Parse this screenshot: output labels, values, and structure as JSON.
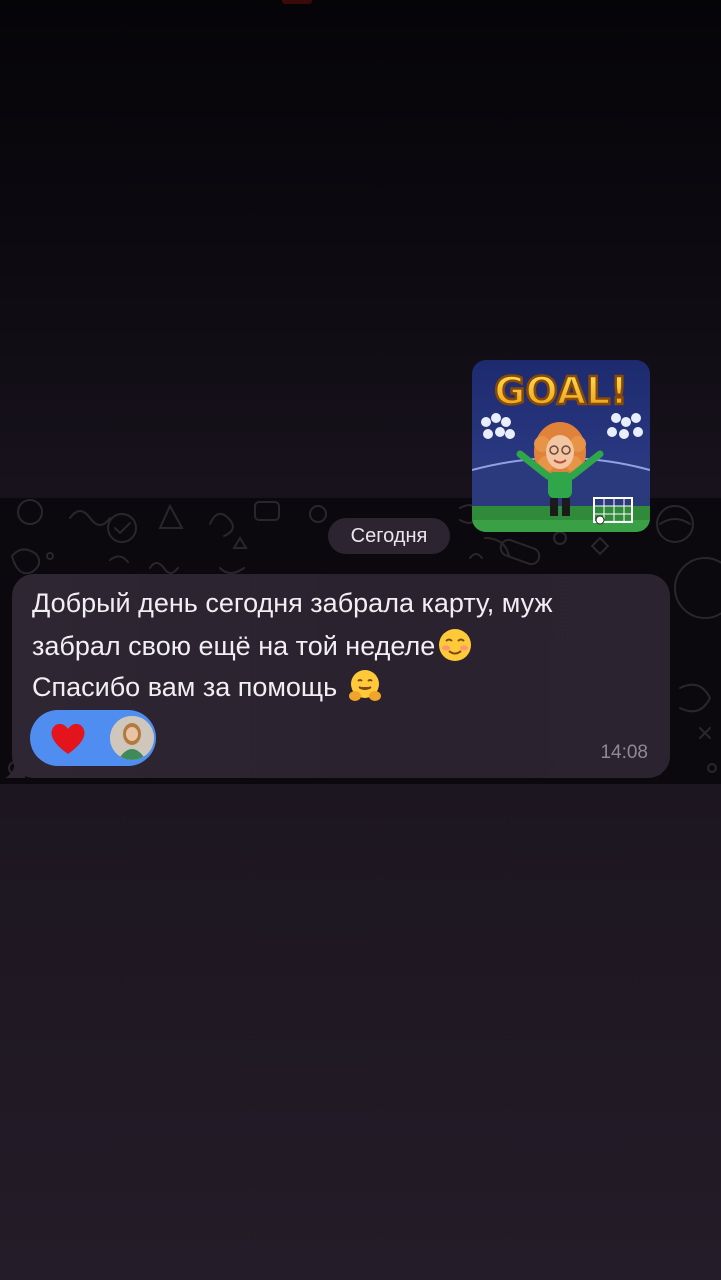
{
  "date_separator": "Сегодня",
  "sticker": {
    "text": "GOAL!",
    "icon": "memoji-goal-sticker-icon"
  },
  "message": {
    "line1": "Добрый день сегодня забрала карту, муж",
    "line2": "забрал свою ещё на той неделе",
    "line3": "Спасибо вам за помощь ",
    "emoji_line2": "smiling-face-icon",
    "emoji_line3": "hugging-face-icon",
    "time": "14:08"
  },
  "reaction": {
    "emoji": "heart-icon",
    "color": "#4f8ef0",
    "avatar": "user-avatar"
  },
  "colors": {
    "bubble": "#2a222e",
    "background": "#1c1620",
    "reaction_bg": "#4f8ef0",
    "heart": "#e3141b"
  }
}
